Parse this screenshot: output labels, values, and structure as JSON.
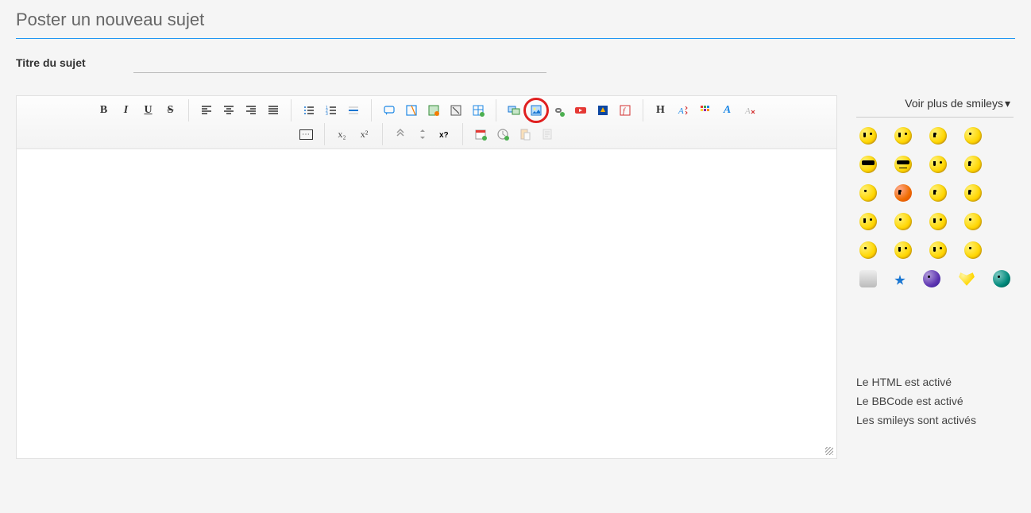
{
  "heading": "Poster un nouveau sujet",
  "field_label": "Titre du sujet",
  "subject_value": "",
  "smileys_header": "Voir plus de smileys",
  "dropdown_caret": "▾",
  "status": {
    "html": "Le HTML est activé",
    "bbcode": "Le BBCode est activé",
    "smileys": "Les smileys sont activés"
  },
  "toolbar": {
    "bold": "B",
    "italic": "I",
    "underline": "U",
    "strike": "S",
    "header": "H",
    "font_a": "A",
    "more": "⋯",
    "sub": "x₂",
    "sup": "x²"
  },
  "textarea_value": ""
}
